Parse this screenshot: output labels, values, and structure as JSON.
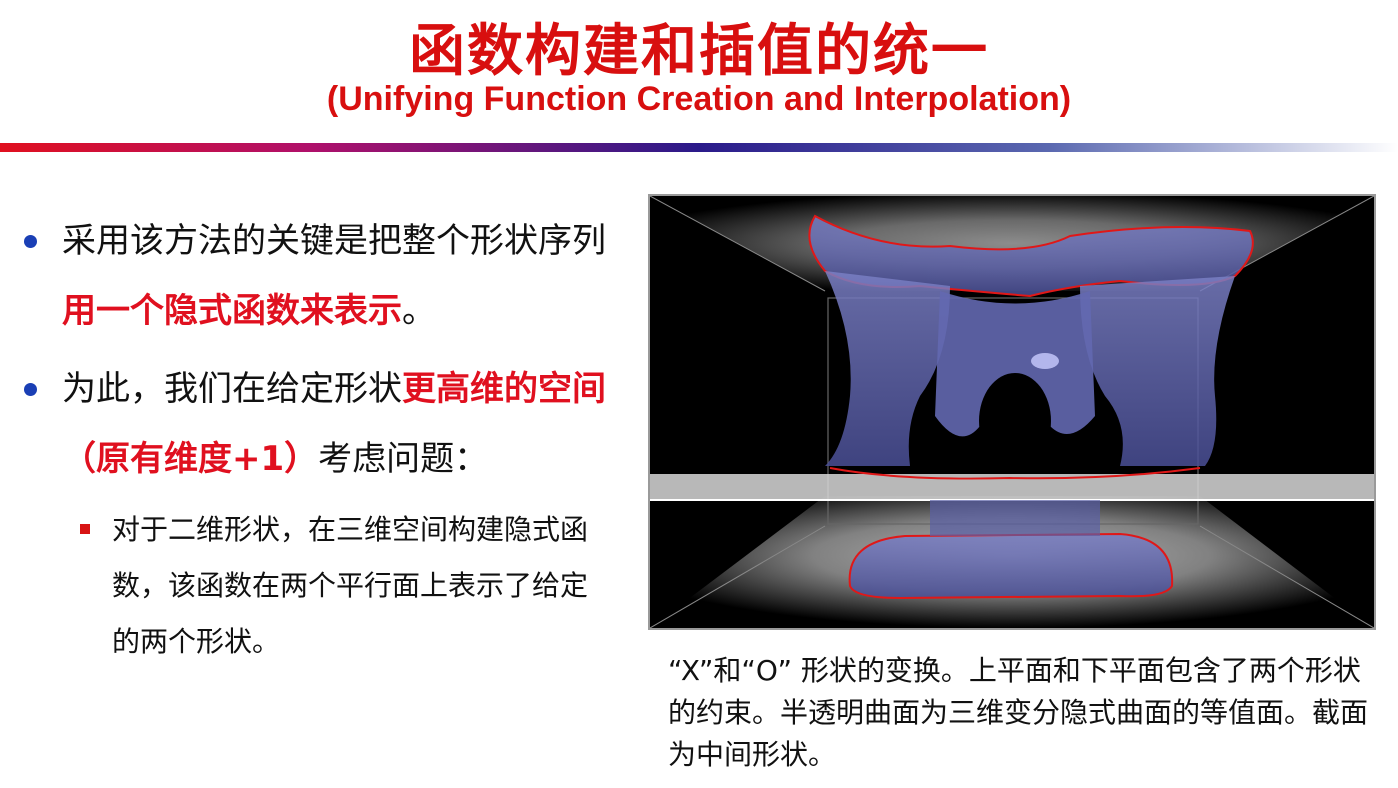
{
  "header": {
    "title": "函数构建和插值的统一",
    "subtitle": "(Unifying Function Creation and Interpolation)"
  },
  "bullets": [
    {
      "parts": [
        {
          "text": "采用该方法的关键是把整个形状序列",
          "highlight": false
        },
        {
          "text": "用一个隐式函数来表示",
          "highlight": true
        },
        {
          "text": "。",
          "highlight": false
        }
      ]
    },
    {
      "parts": [
        {
          "text": "为此，我们在给定形状",
          "highlight": false
        },
        {
          "text": "更高维的空间（原有维度+1）",
          "highlight": true
        },
        {
          "text": "考虑问题：",
          "highlight": false
        }
      ]
    }
  ],
  "sub_bullet": "对于二维形状，在三维空间构建隐式函数，该函数在两个平行面上表示了给定的两个形状。",
  "figure": {
    "caption": "“X”和“O” 形状的变换。上平面和下平面包含了两个形状的约束。半透明曲面为三维变分隐式曲面的等值面。截面为中间形状。"
  },
  "colors": {
    "title_red": "#d80f0f",
    "bullet_blue": "#1a3fb5",
    "highlight_red": "#e0101f",
    "surface_blue": "#6a6fb0"
  }
}
